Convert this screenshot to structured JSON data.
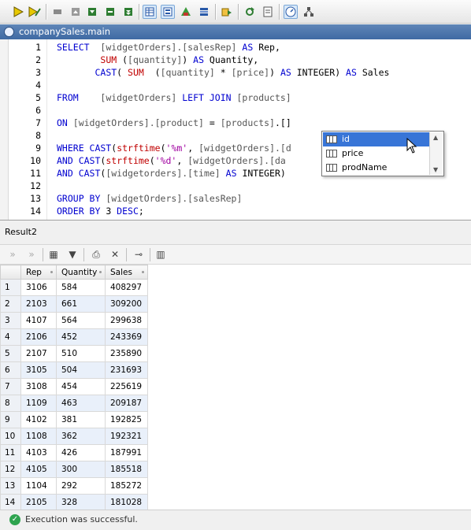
{
  "toolbar": {
    "buttons": [
      "execute-icon",
      "execute-step-icon",
      "stop-icon",
      "move-up-icon",
      "move-down-icon",
      "expand-icon",
      "collapse-icon",
      "grid-view-icon",
      "form-view-icon",
      "tree-icon",
      "list-icon",
      "export-icon",
      "refresh-icon",
      "report-icon",
      "timer-icon",
      "plan-icon"
    ]
  },
  "doc_tab": {
    "title": "companySales.main"
  },
  "editor": {
    "lines": [
      {
        "n": "1",
        "tokens": [
          {
            "c": "kw",
            "t": "SELECT  "
          },
          {
            "c": "ident",
            "t": "[widgetOrders].[salesRep]"
          },
          {
            "c": "kw",
            "t": " AS "
          },
          {
            "c": "pl",
            "t": "Rep,"
          }
        ]
      },
      {
        "n": "2",
        "tokens": [
          {
            "c": "pl",
            "t": "        "
          },
          {
            "c": "fn",
            "t": "SUM"
          },
          {
            "c": "pl",
            "t": " ("
          },
          {
            "c": "ident",
            "t": "[quantity]"
          },
          {
            "c": "pl",
            "t": ")"
          },
          {
            "c": "kw",
            "t": " AS "
          },
          {
            "c": "pl",
            "t": "Quantity,"
          }
        ]
      },
      {
        "n": "3",
        "tokens": [
          {
            "c": "pl",
            "t": "       "
          },
          {
            "c": "kw",
            "t": "CAST"
          },
          {
            "c": "pl",
            "t": "( "
          },
          {
            "c": "fn",
            "t": "SUM"
          },
          {
            "c": "pl",
            "t": "  ("
          },
          {
            "c": "ident",
            "t": "[quantity]"
          },
          {
            "c": "pl",
            "t": " * "
          },
          {
            "c": "ident",
            "t": "[price]"
          },
          {
            "c": "pl",
            "t": ")"
          },
          {
            "c": "kw",
            "t": " AS "
          },
          {
            "c": "pl",
            "t": "INTEGER)"
          },
          {
            "c": "kw",
            "t": " AS "
          },
          {
            "c": "pl",
            "t": "Sales"
          }
        ]
      },
      {
        "n": "4",
        "tokens": []
      },
      {
        "n": "5",
        "tokens": [
          {
            "c": "kw",
            "t": "FROM    "
          },
          {
            "c": "ident",
            "t": "[widgetOrders]"
          },
          {
            "c": "kw",
            "t": " LEFT JOIN "
          },
          {
            "c": "ident",
            "t": "[products]"
          }
        ]
      },
      {
        "n": "6",
        "tokens": []
      },
      {
        "n": "7",
        "tokens": [
          {
            "c": "kw",
            "t": "ON "
          },
          {
            "c": "ident",
            "t": "[widgetOrders].[product]"
          },
          {
            "c": "pl",
            "t": " = "
          },
          {
            "c": "ident",
            "t": "[products]"
          },
          {
            "c": "pl",
            "t": ".[]"
          }
        ]
      },
      {
        "n": "8",
        "tokens": []
      },
      {
        "n": "9",
        "tokens": [
          {
            "c": "kw",
            "t": "WHERE CAST"
          },
          {
            "c": "pl",
            "t": "("
          },
          {
            "c": "fn",
            "t": "strftime"
          },
          {
            "c": "pl",
            "t": "("
          },
          {
            "c": "str",
            "t": "'%m'"
          },
          {
            "c": "pl",
            "t": ", "
          },
          {
            "c": "ident",
            "t": "[widgetOrders].[d"
          }
        ]
      },
      {
        "n": "10",
        "tokens": [
          {
            "c": "kw",
            "t": "AND CAST"
          },
          {
            "c": "pl",
            "t": "("
          },
          {
            "c": "fn",
            "t": "strftime"
          },
          {
            "c": "pl",
            "t": "("
          },
          {
            "c": "str",
            "t": "'%d'"
          },
          {
            "c": "pl",
            "t": ", "
          },
          {
            "c": "ident",
            "t": "[widgetOrders].[da"
          }
        ]
      },
      {
        "n": "11",
        "tokens": [
          {
            "c": "kw",
            "t": "AND CAST"
          },
          {
            "c": "pl",
            "t": "("
          },
          {
            "c": "ident",
            "t": "[widgetorders].[time]"
          },
          {
            "c": "kw",
            "t": " AS "
          },
          {
            "c": "pl",
            "t": "INTEGER)"
          }
        ]
      },
      {
        "n": "12",
        "tokens": []
      },
      {
        "n": "13",
        "tokens": [
          {
            "c": "kw",
            "t": "GROUP BY "
          },
          {
            "c": "ident",
            "t": "[widgetOrders].[salesRep]"
          }
        ]
      },
      {
        "n": "14",
        "tokens": [
          {
            "c": "kw",
            "t": "ORDER BY "
          },
          {
            "c": "pl",
            "t": "3 "
          },
          {
            "c": "kw",
            "t": "DESC"
          },
          {
            "c": "pl",
            "t": ";"
          }
        ]
      }
    ]
  },
  "autocomplete": {
    "items": [
      "id",
      "price",
      "prodName"
    ],
    "selected": "id"
  },
  "result": {
    "label": "Result2",
    "columns": [
      "Rep",
      "Quantity",
      "Sales"
    ],
    "rows": [
      [
        "1",
        "3106",
        "584",
        "408297"
      ],
      [
        "2",
        "2103",
        "661",
        "309200"
      ],
      [
        "3",
        "4107",
        "564",
        "299638"
      ],
      [
        "4",
        "2106",
        "452",
        "243369"
      ],
      [
        "5",
        "2107",
        "510",
        "235890"
      ],
      [
        "6",
        "3105",
        "504",
        "231693"
      ],
      [
        "7",
        "3108",
        "454",
        "225619"
      ],
      [
        "8",
        "1109",
        "463",
        "209187"
      ],
      [
        "9",
        "4102",
        "381",
        "192825"
      ],
      [
        "10",
        "1108",
        "362",
        "192321"
      ],
      [
        "11",
        "4103",
        "426",
        "187991"
      ],
      [
        "12",
        "4105",
        "300",
        "185518"
      ],
      [
        "13",
        "1104",
        "292",
        "185272"
      ],
      [
        "14",
        "2105",
        "328",
        "181028"
      ]
    ]
  },
  "status": {
    "message": "Execution was successful."
  },
  "colors": {
    "keyword": "#0000d0",
    "function": "#c00000",
    "identifier": "#555555",
    "selection": "#3875d7",
    "tab": "#4a72aa",
    "success": "#2ea44f"
  }
}
